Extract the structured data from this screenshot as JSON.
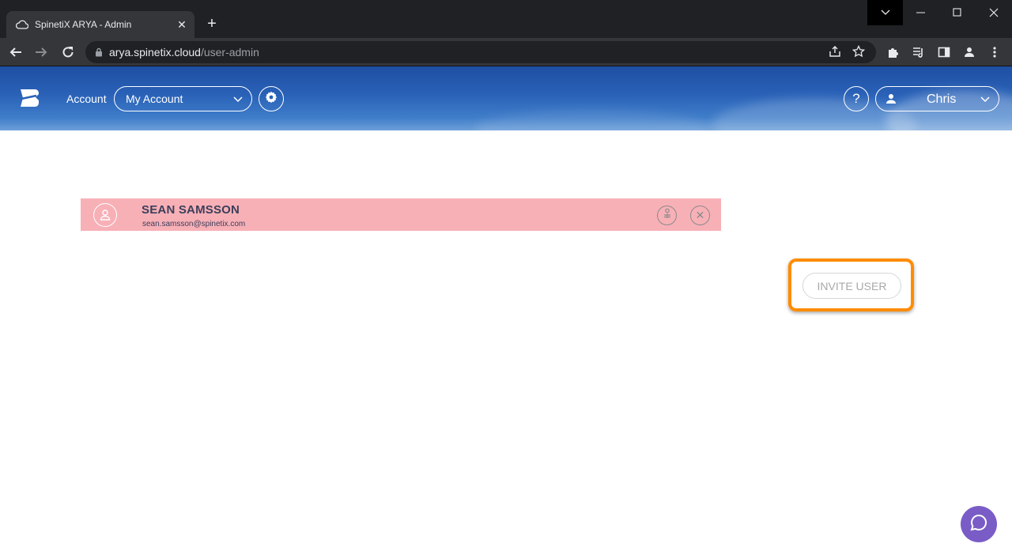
{
  "browser": {
    "tab_title": "SpinetiX ARYA - Admin",
    "tab_close": "✕",
    "new_tab": "+",
    "url_host": "arya.spinetix.cloud",
    "url_path": "/user-admin"
  },
  "header": {
    "account_label": "Account",
    "account_value": "My Account",
    "help_label": "?",
    "user_name": "Chris"
  },
  "users": [
    {
      "name": "SEAN SAMSSON",
      "email": "sean.samsson@spinetix.com",
      "status_color": "#f8b0b7",
      "delete_symbol": "✕"
    }
  ],
  "actions": {
    "invite_label": "INVITE USER",
    "highlight_color": "#ff8c00"
  },
  "colors": {
    "header_blue": "#1e4fa3",
    "chat_purple": "#7a5cc7"
  }
}
